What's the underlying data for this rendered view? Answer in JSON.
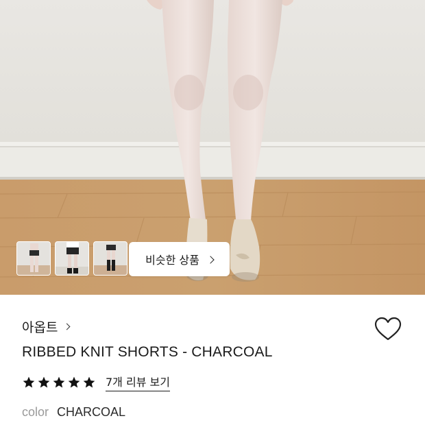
{
  "product": {
    "brand": "아옵트",
    "title": "RIBBED KNIT SHORTS - CHARCOAL",
    "rating": 5,
    "review_link": "7개 리뷰 보기",
    "color_label": "color",
    "color_value": "CHARCOAL"
  },
  "gallery": {
    "similar_button": "비슷한 상품",
    "thumbnail_count": 3
  },
  "colors": {
    "wall": "#e7e5e0",
    "floor": "#c79a68",
    "star": "#111111",
    "heart_outline": "#222222"
  },
  "icons": {
    "heart": "heart-outline-icon",
    "star": "star-filled-icon",
    "chevron": "chevron-right-icon"
  }
}
